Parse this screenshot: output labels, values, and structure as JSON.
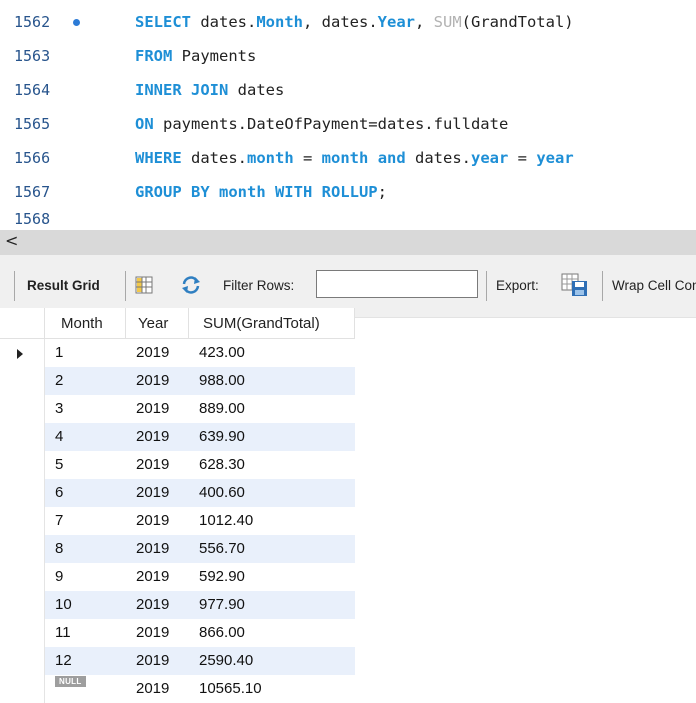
{
  "editor": {
    "lines": [
      {
        "num": "1562",
        "breakpoint": true,
        "segments": [
          [
            "kw",
            "SELECT "
          ],
          [
            "",
            ""
          ],
          [
            "",
            "dates."
          ],
          [
            "kw",
            "Month"
          ],
          [
            "",
            ", dates."
          ],
          [
            "kw",
            "Year"
          ],
          [
            "",
            ", "
          ],
          [
            "fn",
            "SUM"
          ],
          [
            "",
            "(GrandTotal)"
          ]
        ]
      },
      {
        "num": "1563",
        "segments": [
          [
            "kw",
            "FROM "
          ],
          [
            "",
            "Payments"
          ]
        ]
      },
      {
        "num": "1564",
        "segments": [
          [
            "kw",
            "INNER JOIN "
          ],
          [
            "",
            "dates"
          ]
        ]
      },
      {
        "num": "1565",
        "segments": [
          [
            "kw",
            "ON "
          ],
          [
            "",
            "payments.DateOfPayment=dates.fulldate"
          ]
        ]
      },
      {
        "num": "1566",
        "segments": [
          [
            "kw",
            "WHERE "
          ],
          [
            "",
            "dates."
          ],
          [
            "kw",
            "month"
          ],
          [
            "",
            " = "
          ],
          [
            "kw",
            "month"
          ],
          [
            "",
            " "
          ],
          [
            "kw",
            "and"
          ],
          [
            "",
            " dates."
          ],
          [
            "kw",
            "year"
          ],
          [
            "",
            " = "
          ],
          [
            "kw",
            "year"
          ]
        ]
      },
      {
        "num": "1567",
        "segments": [
          [
            "kw",
            "GROUP BY month WITH ROLLUP"
          ],
          [
            "",
            ";"
          ]
        ]
      },
      {
        "num": "1568",
        "segments": []
      }
    ]
  },
  "scrollbar": {
    "left_arrow": "<"
  },
  "toolbar": {
    "result_grid_label": "Result Grid",
    "filter_rows_label": "Filter Rows:",
    "filter_value": "",
    "export_label": "Export:",
    "wrap_label": "Wrap Cell Content"
  },
  "grid": {
    "columns": [
      "Month",
      "Year",
      "SUM(GrandTotal)"
    ],
    "null_label": "NULL",
    "rows": [
      {
        "month": "1",
        "year": "2019",
        "total": "423.00"
      },
      {
        "month": "2",
        "year": "2019",
        "total": "988.00"
      },
      {
        "month": "3",
        "year": "2019",
        "total": "889.00"
      },
      {
        "month": "4",
        "year": "2019",
        "total": "639.90"
      },
      {
        "month": "5",
        "year": "2019",
        "total": "628.30"
      },
      {
        "month": "6",
        "year": "2019",
        "total": "400.60"
      },
      {
        "month": "7",
        "year": "2019",
        "total": "1012.40"
      },
      {
        "month": "8",
        "year": "2019",
        "total": "556.70"
      },
      {
        "month": "9",
        "year": "2019",
        "total": "592.90"
      },
      {
        "month": "10",
        "year": "2019",
        "total": "977.90"
      },
      {
        "month": "11",
        "year": "2019",
        "total": "866.00"
      },
      {
        "month": "12",
        "year": "2019",
        "total": "2590.40"
      },
      {
        "month": null,
        "year": "2019",
        "total": "10565.10"
      }
    ]
  }
}
